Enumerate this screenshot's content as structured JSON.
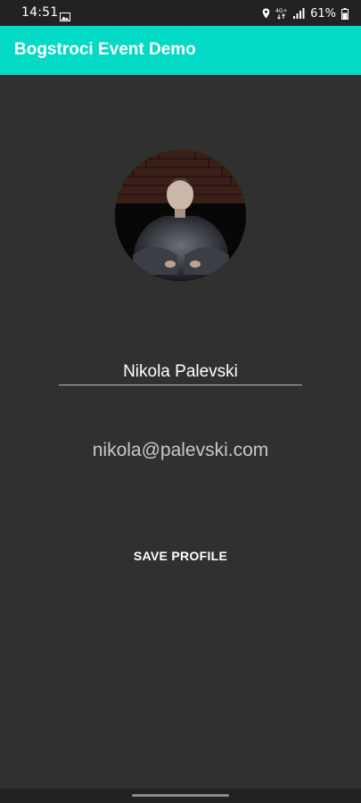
{
  "status_bar": {
    "time": "14:51",
    "network_type": "4G+",
    "battery_percent": "61%",
    "icons": [
      "gallery-icon",
      "location-icon",
      "network-4g-icon",
      "signal-icon",
      "battery-icon"
    ]
  },
  "app_bar": {
    "title": "Bogstroci Event Demo",
    "color": "#03dac5"
  },
  "profile": {
    "avatar_icon": "profile-photo",
    "name": "Nikola Palevski",
    "email": "nikola@palevski.com",
    "save_label": "SAVE PROFILE"
  },
  "colors": {
    "background": "#303030",
    "status_bar": "#222222",
    "accent": "#03dac5"
  }
}
